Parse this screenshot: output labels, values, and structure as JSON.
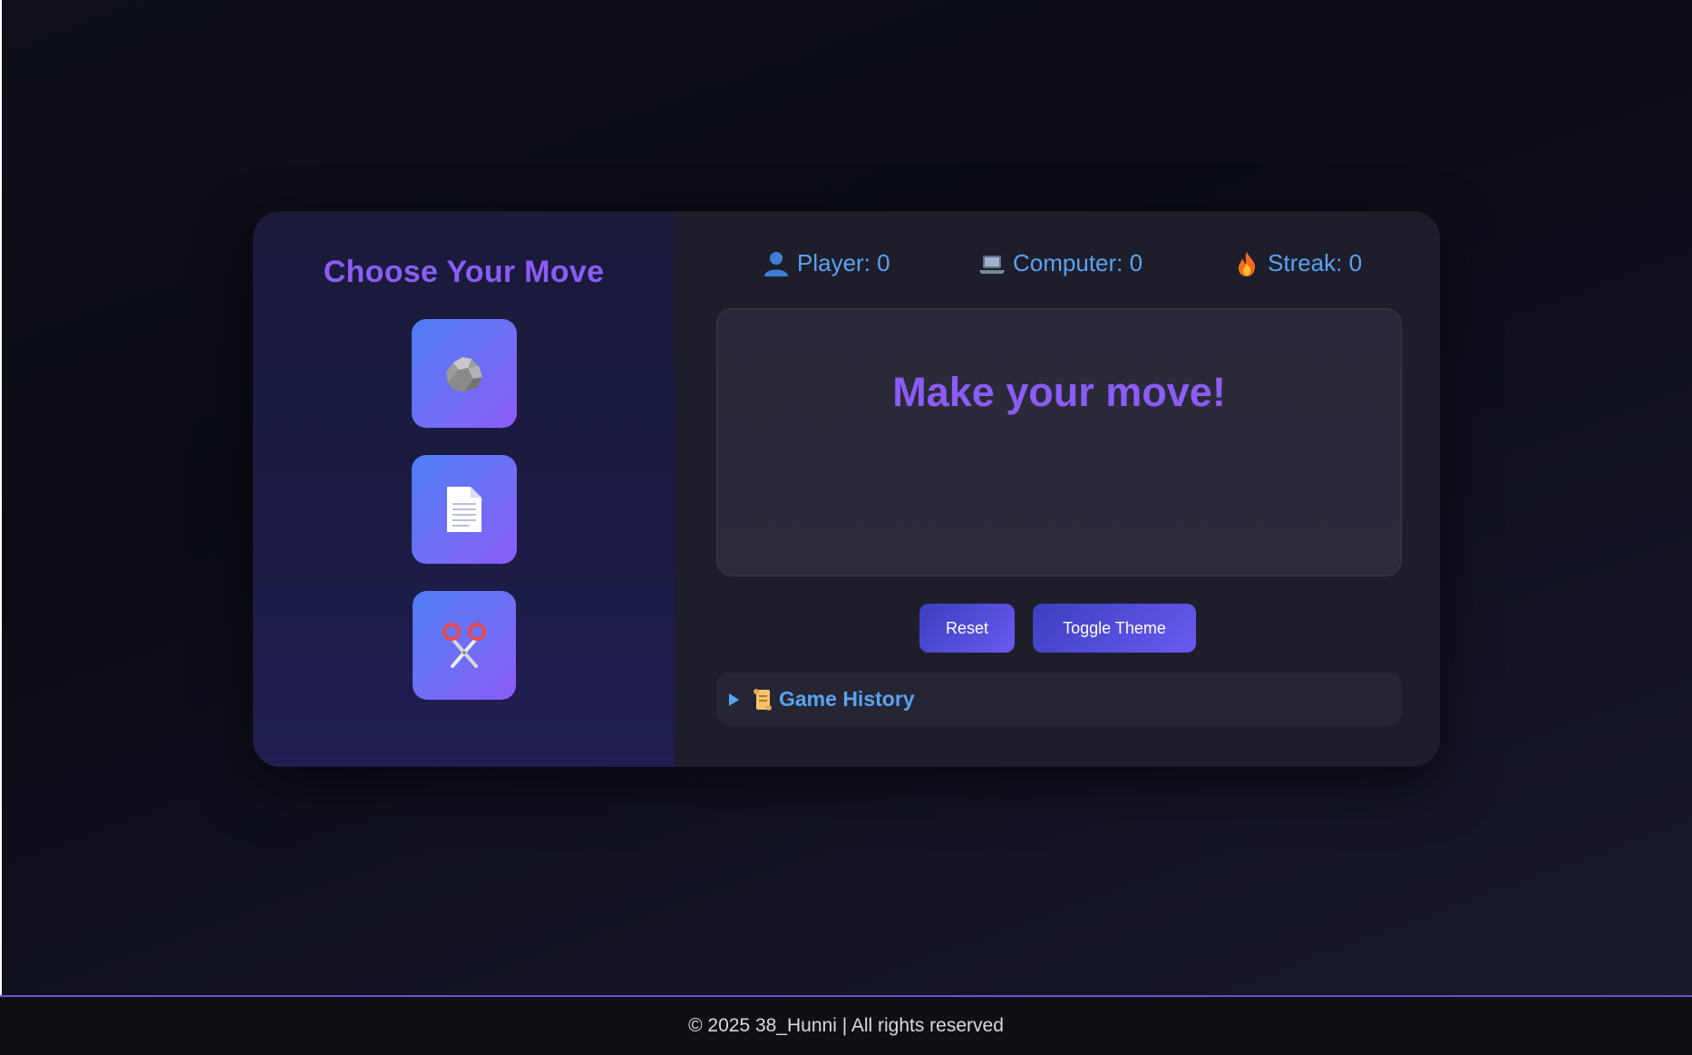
{
  "move_panel": {
    "title": "Choose Your Move",
    "moves": [
      {
        "name": "rock",
        "icon": "rock-icon"
      },
      {
        "name": "paper",
        "icon": "paper-icon"
      },
      {
        "name": "scissors",
        "icon": "scissors-icon"
      }
    ]
  },
  "scoreboard": {
    "player": {
      "icon": "person-icon",
      "text": "Player: 0"
    },
    "computer": {
      "icon": "laptop-icon",
      "text": "Computer: 0"
    },
    "streak": {
      "icon": "fire-icon",
      "text": "Streak: 0"
    }
  },
  "result": {
    "message": "Make your move!"
  },
  "controls": {
    "reset_label": "Reset",
    "toggle_theme_label": "Toggle Theme"
  },
  "history": {
    "icon": "scroll-icon",
    "label": "Game History"
  },
  "footer": {
    "text": "© 2025 38_Hunni | All rights reserved"
  },
  "colors": {
    "accent": "#8b5cf6",
    "score_text": "#5aa2f0",
    "button_gradient_start": "#4f7df5",
    "button_gradient_end": "#8b5cf6",
    "footer_border": "#6b4fd6"
  }
}
